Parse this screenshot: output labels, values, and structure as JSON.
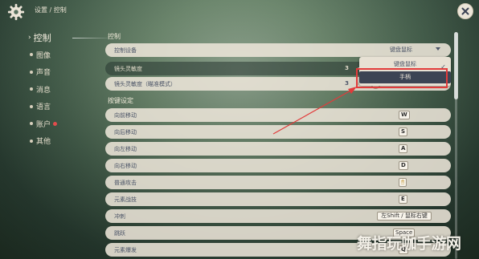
{
  "header": {
    "breadcrumb": "设置 / 控制"
  },
  "sidebar": {
    "items": [
      {
        "label": "控制",
        "active": true
      },
      {
        "label": "图像"
      },
      {
        "label": "声音"
      },
      {
        "label": "消息"
      },
      {
        "label": "语言"
      },
      {
        "label": "账户",
        "badge": true
      },
      {
        "label": "其他"
      }
    ]
  },
  "control": {
    "section_title": "控制",
    "device_label": "控制设备",
    "device_value": "键盘鼠标",
    "lens_sensitivity_label": "镜头灵敏度",
    "lens_sensitivity_value": "3",
    "lens_sensitivity_fraction": 0.2,
    "aim_sensitivity_label": "镜头灵敏度（瞄准模式）",
    "aim_sensitivity_value": "3",
    "aim_sensitivity_fraction": 0.2
  },
  "dropdown": {
    "options": [
      "键盘鼠标",
      "手柄"
    ],
    "selected": "键盘鼠标"
  },
  "keybinds": {
    "section_title": "按键设定",
    "rows": [
      {
        "label": "向前移动",
        "key": "W"
      },
      {
        "label": "向后移动",
        "key": "S"
      },
      {
        "label": "向左移动",
        "key": "A"
      },
      {
        "label": "向右移动",
        "key": "D"
      },
      {
        "label": "普通攻击",
        "key": "🖱"
      },
      {
        "label": "元素战技",
        "key": "E"
      },
      {
        "label": "冲刺",
        "key": "左Shift / 鼠标右键"
      },
      {
        "label": "跳跃",
        "key": "Space"
      },
      {
        "label": "元素爆发",
        "key": "Q"
      }
    ]
  },
  "watermark": "舞指玩咖手游网",
  "colors": {
    "highlight_box": "#e23b3b",
    "row_bg": "#ece5d8",
    "text_dark": "#4a5366"
  }
}
